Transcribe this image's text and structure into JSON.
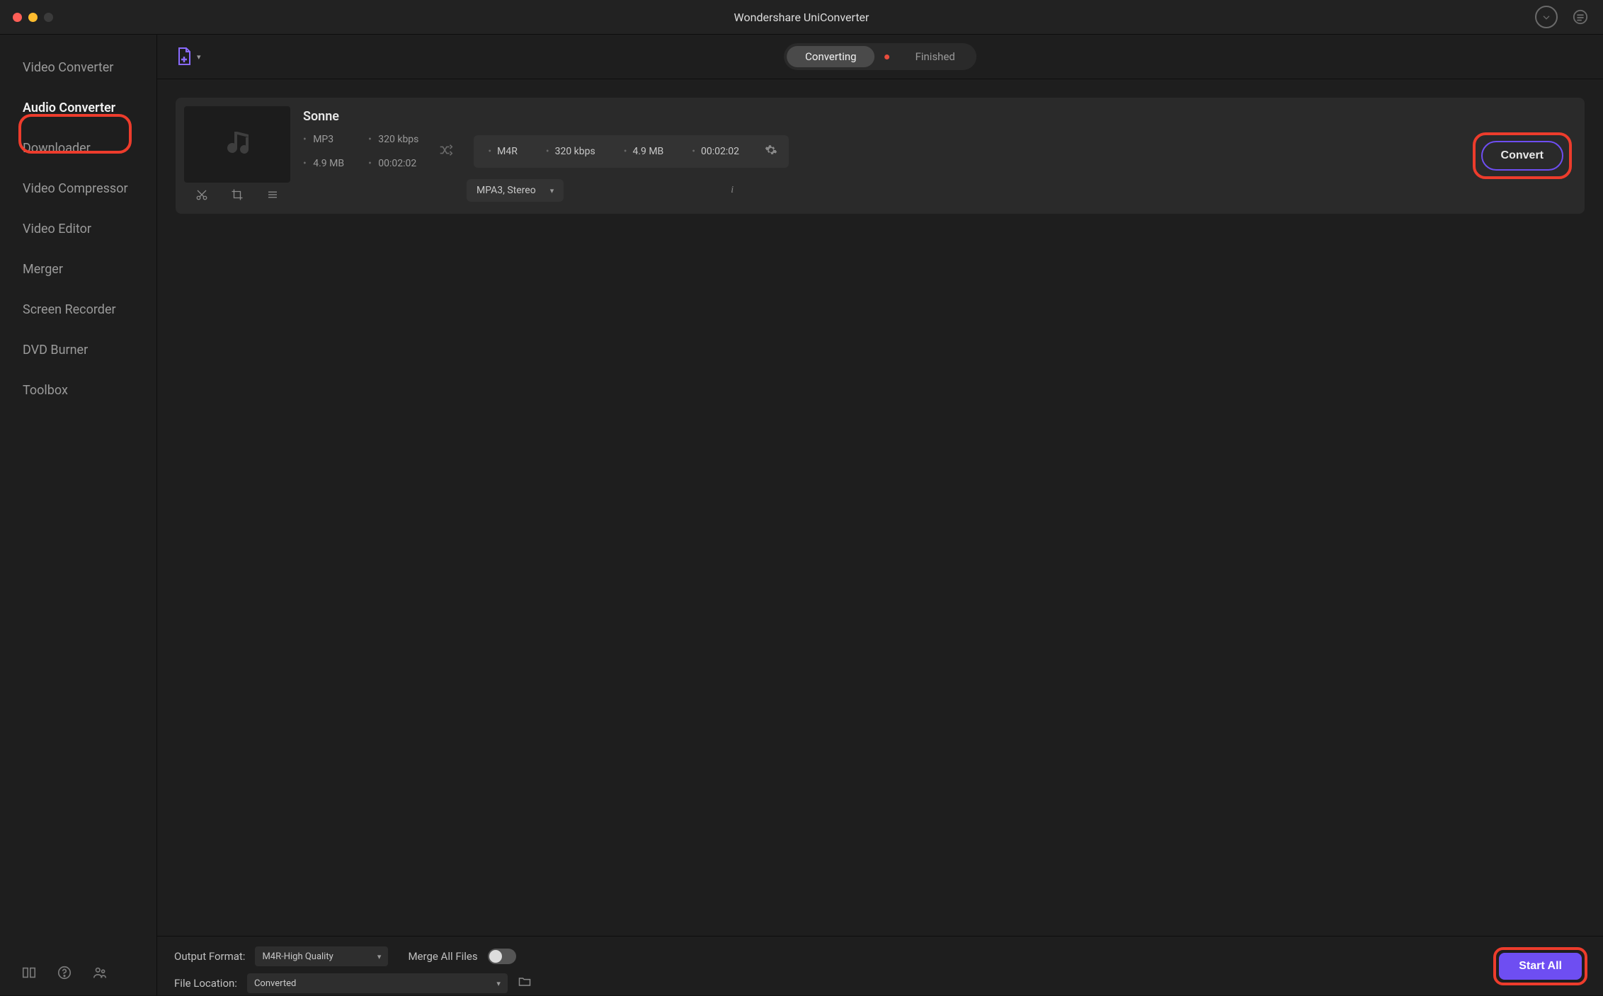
{
  "app": {
    "title": "Wondershare UniConverter"
  },
  "sidebar": {
    "items": [
      {
        "label": "Video Converter"
      },
      {
        "label": "Audio Converter"
      },
      {
        "label": "Downloader"
      },
      {
        "label": "Video Compressor"
      },
      {
        "label": "Video Editor"
      },
      {
        "label": "Merger"
      },
      {
        "label": "Screen Recorder"
      },
      {
        "label": "DVD Burner"
      },
      {
        "label": "Toolbox"
      }
    ],
    "active_index": 1
  },
  "tabs": {
    "converting": "Converting",
    "finished": "Finished",
    "active": "converting"
  },
  "file": {
    "name": "Sonne",
    "source": {
      "format": "MP3",
      "bitrate": "320 kbps",
      "size": "4.9 MB",
      "duration": "00:02:02"
    },
    "target": {
      "format": "M4R",
      "bitrate": "320 kbps",
      "size": "4.9 MB",
      "duration": "00:02:02"
    },
    "channel_dd": "MPA3, Stereo",
    "convert_label": "Convert"
  },
  "footer": {
    "output_format_label": "Output Format:",
    "output_format_value": "M4R-High Quality",
    "merge_label": "Merge All Files",
    "file_location_label": "File Location:",
    "file_location_value": "Converted",
    "start_all": "Start All"
  }
}
